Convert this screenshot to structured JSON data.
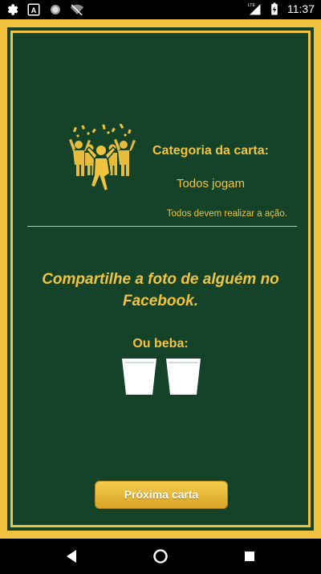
{
  "status_bar": {
    "time": "11:37",
    "network": "LTE",
    "left_icons": [
      "gear-icon",
      "a-icon",
      "circle-icon",
      "wifi-off-icon"
    ],
    "right_icons": [
      "signal-icon",
      "battery-charging-icon"
    ]
  },
  "card": {
    "category_title": "Categoria da carta:",
    "category_name": "Todos jogam",
    "category_description": "Todos devem realizar a ação.",
    "category_icon": "party-crowd-icon",
    "challenge_text": "Compartilhe a foto de alguém no Facebook.",
    "or_drink_label": "Ou beba:",
    "drinks": 2,
    "drink_icon": "shot-glass-icon",
    "next_button_label": "Próxima carta"
  },
  "colors": {
    "gold": "#f2c33f",
    "card_green": "#14432a"
  },
  "nav_bar": {
    "buttons": [
      "back-icon",
      "home-icon",
      "recents-icon"
    ]
  }
}
